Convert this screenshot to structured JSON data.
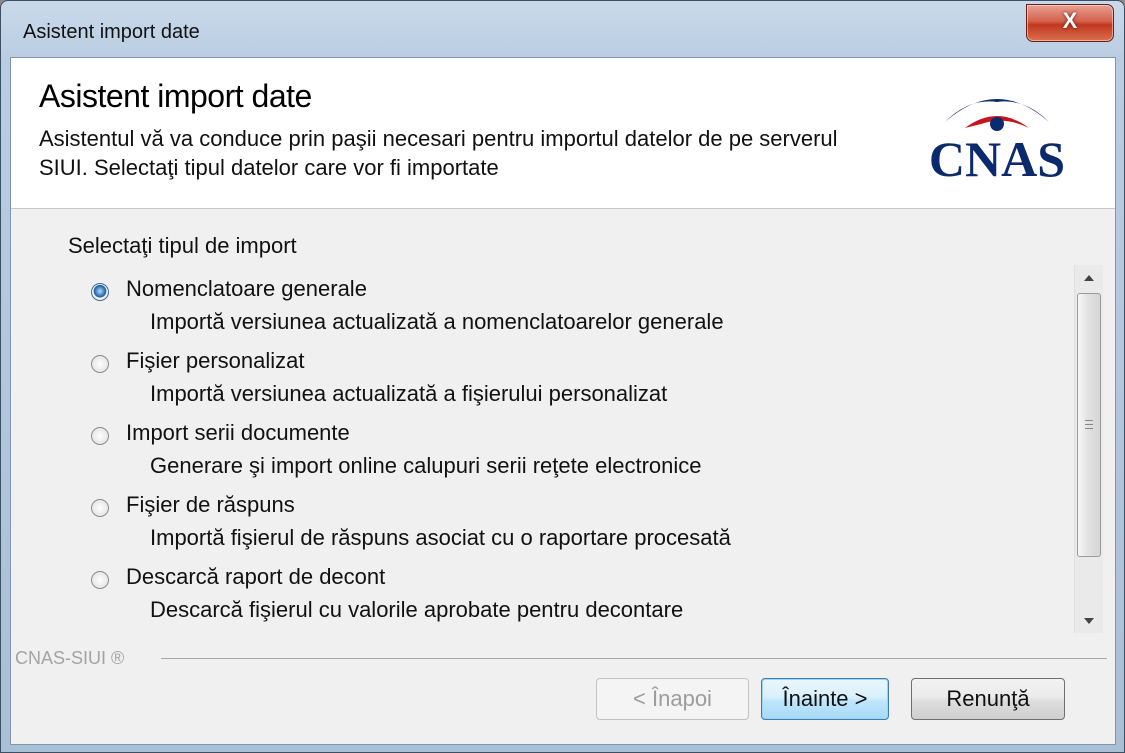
{
  "window": {
    "title": "Asistent import date",
    "close_glyph": "X"
  },
  "header": {
    "title": "Asistent import date",
    "description": "Asistentul vă va conduce prin paşii necesari pentru importul datelor de pe serverul SIUI. Selectaţi tipul datelor care vor fi importate",
    "logo_text": "CNAS",
    "logo_color": "#0b2a6e",
    "logo_accent_color": "#c4161c"
  },
  "section": {
    "label": "Selectaţi tipul de import"
  },
  "options": [
    {
      "label": "Nomenclatoare generale",
      "description": "Importă versiunea actualizată a nomenclatoarelor generale",
      "selected": true
    },
    {
      "label": "Fişier personalizat",
      "description": "Importă versiunea actualizată a fişierului personalizat",
      "selected": false
    },
    {
      "label": "Import serii documente",
      "description": "Generare şi import online calupuri serii reţete electronice",
      "selected": false
    },
    {
      "label": "Fişier de răspuns",
      "description": "Importă fişierul de răspuns asociat cu o raportare procesată",
      "selected": false
    },
    {
      "label": "Descarcă raport de decont",
      "description": "Descarcă fişierul cu valorile aprobate pentru decontare",
      "selected": false
    }
  ],
  "brand": {
    "text": "CNAS-SIUI ®"
  },
  "buttons": {
    "back": {
      "label": "< Înapoi",
      "enabled": false
    },
    "next": {
      "label": "Înainte >",
      "enabled": true
    },
    "cancel": {
      "label": "Renunţă",
      "enabled": true
    }
  }
}
